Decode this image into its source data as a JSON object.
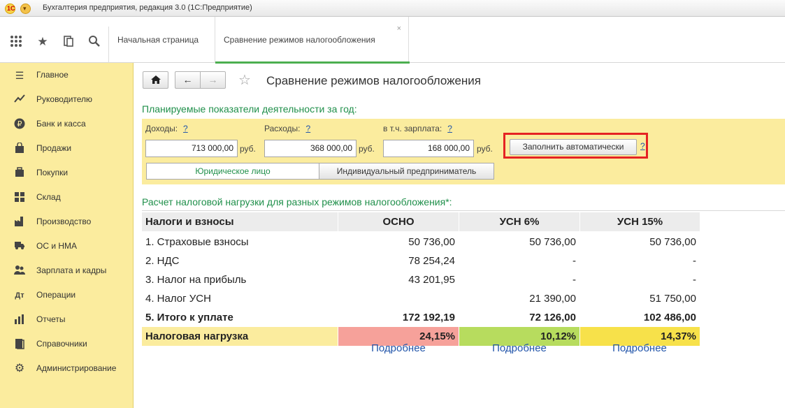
{
  "window": {
    "title": "Бухгалтерия предприятия, редакция 3.0 (1С:Предприятие)",
    "logo_text": "1С"
  },
  "tabs": [
    {
      "label": "Начальная страница"
    },
    {
      "label": "Сравнение режимов налогообложения",
      "active": true
    }
  ],
  "sidebar": {
    "items": [
      {
        "label": "Главное",
        "icon": "list-icon"
      },
      {
        "label": "Руководителю",
        "icon": "trend-icon"
      },
      {
        "label": "Банк и касса",
        "icon": "ruble-icon"
      },
      {
        "label": "Продажи",
        "icon": "bag-icon"
      },
      {
        "label": "Покупки",
        "icon": "cart-icon"
      },
      {
        "label": "Склад",
        "icon": "warehouse-icon"
      },
      {
        "label": "Производство",
        "icon": "factory-icon"
      },
      {
        "label": "ОС и НМА",
        "icon": "truck-icon"
      },
      {
        "label": "Зарплата и кадры",
        "icon": "people-icon"
      },
      {
        "label": "Операции",
        "icon": "operations-icon"
      },
      {
        "label": "Отчеты",
        "icon": "bar-chart-icon"
      },
      {
        "label": "Справочники",
        "icon": "book-icon"
      },
      {
        "label": "Администрирование",
        "icon": "gear-icon"
      }
    ]
  },
  "page": {
    "title": "Сравнение режимов налогообложения",
    "plan_heading": "Планируемые показатели деятельности за год:",
    "income": {
      "label": "Доходы:",
      "value": "713 000,00",
      "unit": "руб.",
      "help": "?"
    },
    "expenses": {
      "label": "Расходы:",
      "value": "368 000,00",
      "unit": "руб.",
      "help": "?"
    },
    "salary": {
      "label": "в т.ч. зарплата:",
      "value": "168 000,00",
      "unit": "руб.",
      "help": "?"
    },
    "fill_button": "Заполнить автоматически",
    "fill_help": "?",
    "segments": [
      "Юридическое лицо",
      "Индивидуальный предприниматель"
    ],
    "calc_heading": "Расчет налоговой нагрузки для разных режимов налогообложения*:",
    "table": {
      "headers": [
        "Налоги и взносы",
        "ОСНО",
        "УСН 6%",
        "УСН 15%"
      ],
      "rows": [
        [
          "1. Страховые взносы",
          "50 736,00",
          "50 736,00",
          "50 736,00"
        ],
        [
          "2. НДС",
          "78 254,24",
          "-",
          "-"
        ],
        [
          "3. Налог на прибыль",
          "43 201,95",
          "-",
          "-"
        ],
        [
          "4. Налог УСН",
          "",
          "21 390,00",
          "51 750,00"
        ],
        [
          "5. Итого к уплате",
          "172 192,19",
          "72 126,00",
          "102 486,00"
        ],
        [
          "Налоговая нагрузка",
          "24,15%",
          "10,12%",
          "14,37%"
        ]
      ],
      "load_colors": [
        "#f6a19a",
        "#b7dc5e",
        "#f7e14a"
      ]
    },
    "details_link": "Подробнее"
  }
}
